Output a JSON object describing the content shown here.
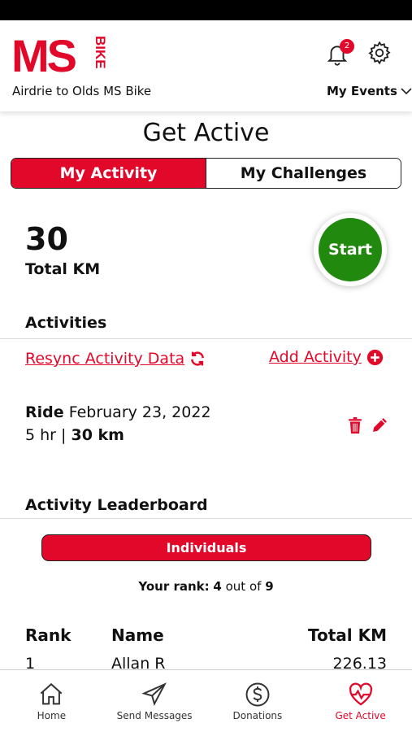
{
  "header": {
    "logo_text": "MS",
    "logo_bike": "BIKE",
    "event_name": "Airdrie to Olds MS Bike",
    "notification_count": "2",
    "my_events_label": "My Events",
    "brand_color": "#e1082a"
  },
  "page": {
    "title": "Get Active"
  },
  "tabs": [
    {
      "label": "My Activity",
      "active": true
    },
    {
      "label": "My Challenges",
      "active": false
    }
  ],
  "summary": {
    "total_value": "30",
    "total_label": "Total KM",
    "start_label": "Start",
    "start_color": "#218a0e"
  },
  "activities": {
    "title": "Activities",
    "resync_label": "Resync Activity Data",
    "add_label": "Add Activity",
    "items": [
      {
        "type": "Ride",
        "date": "February 23, 2022",
        "duration": "5 hr",
        "separator": "|",
        "distance": "30 km"
      }
    ]
  },
  "leaderboard": {
    "title": "Activity Leaderboard",
    "filter_label": "Individuals",
    "your_rank_label": "Your rank:",
    "your_rank": "4",
    "out_of_label": "out of",
    "total": "9",
    "columns": [
      "Rank",
      "Name",
      "Total KM"
    ],
    "rows": [
      {
        "rank": "1",
        "name": "Allan R",
        "total": "226.13"
      }
    ]
  },
  "nav": [
    {
      "label": "Home",
      "icon": "home-icon"
    },
    {
      "label": "Send Messages",
      "icon": "paper-plane-icon"
    },
    {
      "label": "Donations",
      "icon": "dollar-circle-icon"
    },
    {
      "label": "Get Active",
      "icon": "heart-pulse-icon",
      "active": true
    }
  ]
}
